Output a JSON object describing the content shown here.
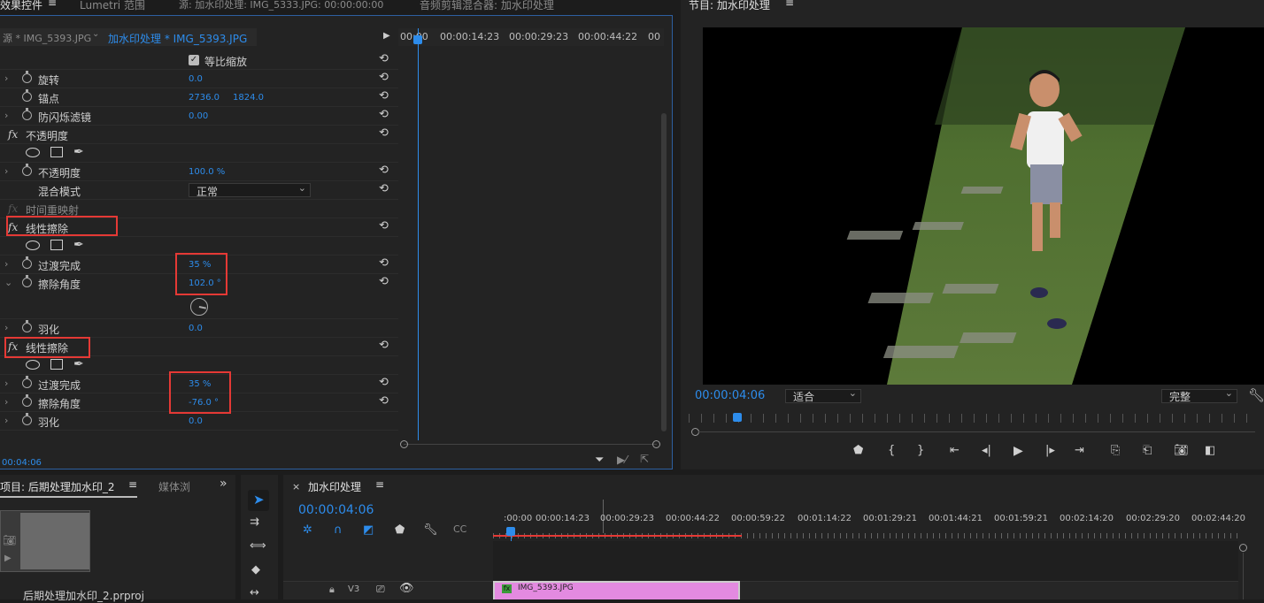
{
  "top_tabs": {
    "effect_controls": "效果控件",
    "lumetri": "Lumetri 范围",
    "source": "源: 加水印处理: IMG_5333.JPG: 00:00:00:00",
    "audio_mixer": "音频剪辑混合器: 加水印处理",
    "program": "节目: 加水印处理"
  },
  "ec": {
    "source_tab": "源 * IMG_5393.JPG",
    "seq_tab": "加水印处理 * IMG_5393.JPG",
    "ruler": [
      "00:00",
      "00:00:14:23",
      "00:00:29:23",
      "00:00:44:22",
      "00"
    ],
    "uniform_scale": "等比缩放",
    "rotation": {
      "label": "旋转",
      "value": "0.0"
    },
    "anchor": {
      "label": "锚点",
      "x": "2736.0",
      "y": "1824.0"
    },
    "antiflicker": {
      "label": "防闪烁滤镜",
      "value": "0.00"
    },
    "opacity_section": "不透明度",
    "opacity": {
      "label": "不透明度",
      "value": "100.0 %"
    },
    "blend": {
      "label": "混合模式",
      "value": "正常"
    },
    "time_remap": "时间重映射",
    "wipe1": {
      "title": "线性擦除",
      "completion_label": "过渡完成",
      "completion": "35 %",
      "angle_label": "擦除角度",
      "angle": "102.0 °",
      "feather_label": "羽化",
      "feather": "0.0"
    },
    "wipe2": {
      "title": "线性擦除",
      "completion_label": "过渡完成",
      "completion": "35 %",
      "angle_label": "擦除角度",
      "angle": "-76.0 °",
      "feather_label": "羽化",
      "feather": "0.0"
    },
    "timecode": "00:04:06"
  },
  "program": {
    "timecode": "00:00:04:06",
    "fit": "适合",
    "quality": "完整"
  },
  "project": {
    "title": "项目: 后期处理加水印_2",
    "media_tab": "媒体浏",
    "file": "后期处理加水印_2.prproj"
  },
  "timeline": {
    "title": "加水印处理",
    "timecode": "00:00:04:06",
    "ruler": [
      ":00:00",
      "00:00:14:23",
      "00:00:29:23",
      "00:00:44:22",
      "00:00:59:22",
      "00:01:14:22",
      "00:01:29:21",
      "00:01:44:21",
      "00:01:59:21",
      "00:02:14:20",
      "00:02:29:20",
      "00:02:44:20"
    ],
    "track": "V3",
    "clip": "IMG_5393.JPG"
  },
  "colors": {
    "accent": "#2d8ceb",
    "highlight": "#e53935",
    "clip": "#e38ae0"
  }
}
